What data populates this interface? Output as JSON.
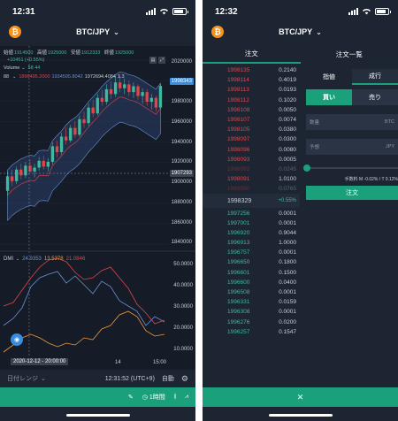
{
  "left": {
    "status_time": "12:31",
    "pair": "BTC/JPY",
    "ohlc": [
      {
        "label": "始値",
        "value": "1914500"
      },
      {
        "label": "高値",
        "value": "1925000"
      },
      {
        "label": "安値",
        "value": "1912333"
      },
      {
        "label": "終値",
        "value": "1925000"
      }
    ],
    "change": "+10451 (+0.55%)",
    "volume_label": "Volume",
    "volume_values": "58  44",
    "bb_label": "88",
    "bb_values": [
      "1896495.2000",
      "1934595.8042",
      "1972694.4084",
      "1.3"
    ],
    "price_axis": [
      "2020000",
      "2000000",
      "1980000",
      "1960000",
      "1940000",
      "1920000",
      "1900000",
      "1880000",
      "1860000",
      "1840000"
    ],
    "current_price_tag": "1998343",
    "cross_price_tag": "1907293",
    "dmi_label": "DMI",
    "dmi_values": [
      "24.9353",
      "13.5378",
      "21.0846"
    ],
    "dmi_axis": [
      "50.0000",
      "40.0000",
      "30.0000",
      "20.0000",
      "10.0000"
    ],
    "date_tag": "2020-12-12 - 20:00:00",
    "x_label_14": "14",
    "x_label_15": "15:00",
    "footer": {
      "range": "日付レンジ",
      "time": "12:31:52 (UTC+9)",
      "auto": "自動"
    },
    "green_bar": {
      "interval": "1時間"
    },
    "chart_data": {
      "type": "candlestick",
      "ylim": [
        1835000,
        2025000
      ],
      "candles": [
        [
          1890000,
          1910000,
          1885000,
          1905000
        ],
        [
          1905000,
          1912000,
          1895000,
          1900000
        ],
        [
          1900000,
          1915000,
          1897000,
          1912000
        ],
        [
          1912000,
          1918000,
          1902000,
          1906000
        ],
        [
          1906000,
          1920000,
          1903000,
          1916000
        ],
        [
          1916000,
          1922000,
          1908000,
          1910000
        ],
        [
          1910000,
          1918000,
          1904000,
          1914000
        ],
        [
          1914000,
          1925000,
          1911000,
          1921000
        ],
        [
          1921000,
          1926000,
          1912000,
          1915000
        ],
        [
          1915000,
          1924000,
          1910000,
          1920000
        ],
        [
          1920000,
          1940000,
          1917000,
          1936000
        ],
        [
          1936000,
          1942000,
          1925000,
          1930000
        ],
        [
          1930000,
          1950000,
          1927000,
          1946000
        ],
        [
          1946000,
          1955000,
          1938000,
          1942000
        ],
        [
          1942000,
          1958000,
          1940000,
          1955000
        ],
        [
          1955000,
          1962000,
          1945000,
          1948000
        ],
        [
          1948000,
          1968000,
          1946000,
          1964000
        ],
        [
          1964000,
          1972000,
          1955000,
          1960000
        ],
        [
          1960000,
          1980000,
          1957000,
          1976000
        ],
        [
          1976000,
          1984000,
          1966000,
          1970000
        ],
        [
          1970000,
          1990000,
          1968000,
          1986000
        ],
        [
          1986000,
          1994000,
          1978000,
          1982000
        ],
        [
          1982000,
          2000000,
          1979000,
          1995000
        ],
        [
          1995000,
          2003000,
          1985000,
          1990000
        ],
        [
          1990000,
          2008000,
          1987000,
          2002000
        ],
        [
          2002000,
          2010000,
          1992000,
          1996000
        ],
        [
          1996000,
          2006000,
          1990000,
          2000000
        ],
        [
          2000000,
          2004000,
          1988000,
          1992000
        ],
        [
          1992000,
          2002000,
          1986000,
          1998000
        ],
        [
          1998000,
          2000000,
          1984000,
          1988000
        ],
        [
          1988000,
          1996000,
          1980000,
          1992000
        ],
        [
          1992000,
          1995000,
          1978000,
          1982000
        ],
        [
          1982000,
          1990000,
          1974000,
          1986000
        ],
        [
          1986000,
          1988000,
          1972000,
          1976000
        ],
        [
          1976000,
          2000000,
          1974000,
          1998343
        ]
      ]
    }
  },
  "right": {
    "status_time": "12:32",
    "pair": "BTC/JPY",
    "tabs": [
      "注文",
      "注文一覧"
    ],
    "asks": [
      {
        "price": "1998135",
        "qty": "0.2140"
      },
      {
        "price": "1998114",
        "qty": "0.4019"
      },
      {
        "price": "1998113",
        "qty": "0.0193"
      },
      {
        "price": "1998112",
        "qty": "0.1020"
      },
      {
        "price": "1998108",
        "qty": "0.0050"
      },
      {
        "price": "1998107",
        "qty": "0.0074"
      },
      {
        "price": "1998105",
        "qty": "0.0380"
      },
      {
        "price": "1998097",
        "qty": "0.0300"
      },
      {
        "price": "1998096",
        "qty": "0.0080"
      },
      {
        "price": "1998093",
        "qty": "0.0005"
      },
      {
        "price": "1998092",
        "qty": "0.0245"
      },
      {
        "price": "1998091",
        "qty": "1.0100"
      },
      {
        "price": "1998090",
        "qty": "0.0765"
      }
    ],
    "mid_price": "1998329",
    "mid_change": "+0.55%",
    "bids": [
      {
        "price": "1997256",
        "qty": "0.0001"
      },
      {
        "price": "1997001",
        "qty": "0.0001"
      },
      {
        "price": "1996920",
        "qty": "0.9044"
      },
      {
        "price": "1996913",
        "qty": "1.0000"
      },
      {
        "price": "1996757",
        "qty": "0.0001"
      },
      {
        "price": "1996650",
        "qty": "0.1800"
      },
      {
        "price": "1996601",
        "qty": "0.1500"
      },
      {
        "price": "1996600",
        "qty": "0.0400"
      },
      {
        "price": "1996508",
        "qty": "0.0001"
      },
      {
        "price": "1996331",
        "qty": "0.0159"
      },
      {
        "price": "1996308",
        "qty": "0.0001"
      },
      {
        "price": "1996276",
        "qty": "0.0200"
      },
      {
        "price": "1996257",
        "qty": "0.1547"
      }
    ],
    "order_types": [
      "指値",
      "成行"
    ],
    "sides": [
      "買い",
      "売り"
    ],
    "qty_field": {
      "label": "数量",
      "unit": "BTC"
    },
    "est_field": {
      "label": "予想",
      "unit": "JPY"
    },
    "fee_note": "手数料 M -0.02% / T 0.12%",
    "order_button": "注文",
    "close_symbol": "✕"
  }
}
